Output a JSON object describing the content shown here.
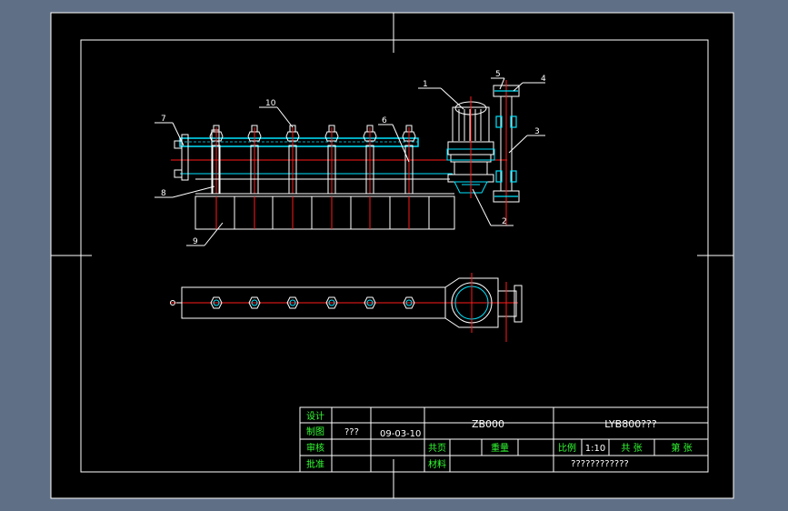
{
  "colors": {
    "background": "#5f6f86",
    "paper": "#000000",
    "line": "#ffffff",
    "accent_cyan": "#00e5ff",
    "center_red": "#ff1a1a",
    "title_green": "#33ff33"
  },
  "balloons": [
    "1",
    "2",
    "3",
    "4",
    "5",
    "6",
    "7",
    "8",
    "9",
    "10"
  ],
  "title_block": {
    "row_labels": [
      "设计",
      "制图",
      "审核",
      "批准"
    ],
    "drafter": "???",
    "date": "09-03-10",
    "drawing_code": "ZB000",
    "drawing_name": "LYB800???",
    "label_count": "共页",
    "label_weight": "重量",
    "label_material": "材料",
    "label_scale": "比例",
    "scale": "1:10",
    "label_sheet_total": "共 张",
    "label_sheet_no": "第 张",
    "company": "????????????"
  }
}
